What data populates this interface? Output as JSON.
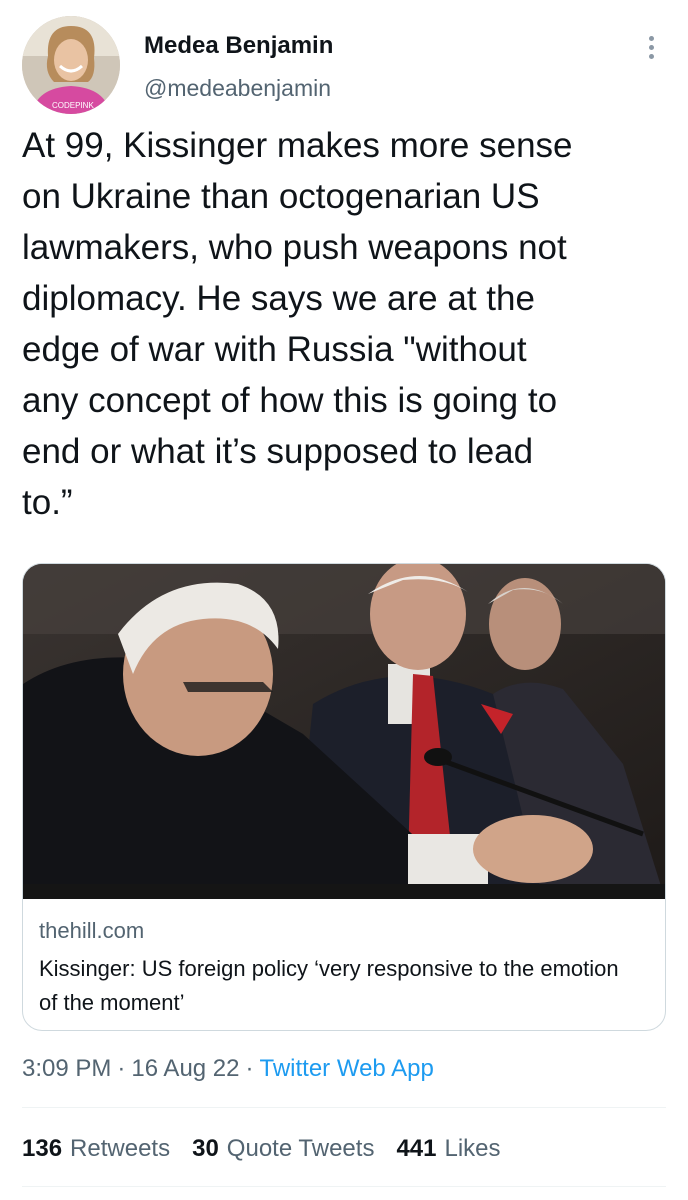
{
  "author": {
    "display_name": "Medea Benjamin",
    "handle": "@medeabenjamin",
    "avatar_shirt_text": "CODEPINK"
  },
  "tweet": {
    "text": "At 99, Kissinger makes more sense\non Ukraine than octogenarian US\nlawmakers, who push weapons not\ndiplomacy. He says we are at the\nedge of war with Russia \"without\nany concept of how this is going to\nend or what it’s supposed to lead\nto.”"
  },
  "link_card": {
    "domain": "thehill.com",
    "title": "Kissinger: US foreign policy ‘very responsive to the emotion of the moment’"
  },
  "meta": {
    "time": "3:09 PM",
    "date": "16 Aug 22",
    "separator": "·",
    "source": "Twitter Web App"
  },
  "stats": {
    "retweets_count": "136",
    "retweets_label": "Retweets",
    "quotes_count": "30",
    "quotes_label": "Quote Tweets",
    "likes_count": "441",
    "likes_label": "Likes"
  },
  "icons": {
    "more": "more-horizontal-icon"
  },
  "colors": {
    "link": "#1d9bf0",
    "secondary_text": "#536471",
    "primary_text": "#0f1419",
    "border": "#cfd9de"
  }
}
